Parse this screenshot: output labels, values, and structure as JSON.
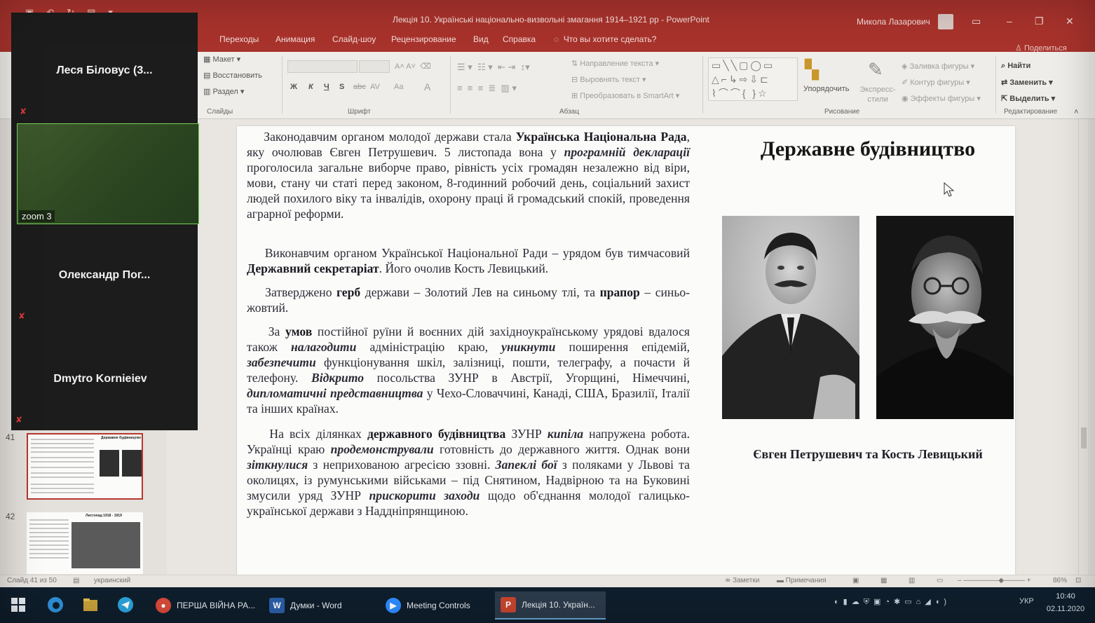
{
  "window": {
    "title": "Лекція 10. Українські національно-визвольні змагання 1914–1921 рр  -  PowerPoint",
    "user": "Микола Лазарович"
  },
  "menu": {
    "tabs": [
      "Переходы",
      "Анимация",
      "Слайд-шоу",
      "Рецензирование",
      "Вид",
      "Справка"
    ],
    "search": "Что вы хотите сделать?",
    "share": "Поделиться"
  },
  "ribbon": {
    "slides_group": {
      "layout": "Макет",
      "reset": "Восстановить",
      "section": "Раздел",
      "label": "Слайды"
    },
    "font_group": {
      "label": "Шрифт",
      "bold": "Ж",
      "italic": "К",
      "underline": "Ч",
      "shadow": "S",
      "strike": "abc",
      "spacing": "AV",
      "case": "Aa",
      "color": "A"
    },
    "paragraph_group": {
      "label": "Абзац",
      "text_direction": "Направление текста",
      "align_text": "Выровнять текст",
      "smartart": "Преобразовать в SmartArt"
    },
    "drawing_group": {
      "label": "Рисование",
      "arrange": "Упорядочить",
      "quick_styles": "Экспресс-стили",
      "fill": "Заливка фигуры",
      "outline": "Контур фигуры",
      "effects": "Эффекты фигуры"
    },
    "editing_group": {
      "label": "Редактирование",
      "find": "Найти",
      "replace": "Заменить",
      "select": "Выделить"
    }
  },
  "zoom": {
    "participants": [
      {
        "name": "Леся Біловус (3...",
        "muted": true
      },
      {
        "name": "zoom 3",
        "video": true
      },
      {
        "name": "Олександр  Пог...",
        "muted": true
      },
      {
        "name": "Dmytro Kornieiev",
        "muted": true
      }
    ]
  },
  "thumbnails": [
    {
      "number": "41",
      "title": "Державне будівництво",
      "selected": true
    },
    {
      "number": "42",
      "title": "Листопад 1918 - 1919",
      "selected": false
    }
  ],
  "slide": {
    "title": "Державне будівництво",
    "caption": "Євген Петрушевич та Кость Левицький",
    "paragraphs": {
      "p1_a": "Законодавчим органом молодої держави стала ",
      "p1_b": "Українська Національна Рада",
      "p1_c": ", яку очолював Євген Петрушевич. 5 листопада вона у ",
      "p1_d": "програмній декларації",
      "p1_e": " проголосила загальне виборче право, рівність усіх громадян незалежно від віри, мови, стану чи статі перед законом, 8-годинний робочий день, соціальний захист людей похилого віку та інвалідів, охорону праці й громадський спокій, проведення аграрної реформи.",
      "p2_a": "Виконавчим органом Української Національної Ради – урядом був тимчасовий ",
      "p2_b": "Державний секретаріат",
      "p2_c": ". Його очолив Кость Левицький.",
      "p3_a": "Затверджено ",
      "p3_b": "герб",
      "p3_c": " держави – Золотий Лев на синьому тлі, та ",
      "p3_d": "прапор",
      "p3_e": " – синьо-жовтий.",
      "p4_a": "За ",
      "p4_b": "умов",
      "p4_c": " постійної руїни й воєнних дій західноукраїнському урядові вдалося також ",
      "p4_d": "налагодити",
      "p4_e": " адміністрацію краю, ",
      "p4_f": "уникнути",
      "p4_g": " поширення епідемій, ",
      "p4_h": "забезпечити",
      "p4_i": " функціонування шкіл, залізниці, пошти, телеграфу, а почасти й телефону. ",
      "p4_j": "Відкрито",
      "p4_k": " посольства ЗУНР в Австрії, Угорщині, Німеччині, ",
      "p4_l": "дипломатичні представництва",
      "p4_m": " у Чехо-Словаччині, Канаді, США, Бразилії, Італії та інших країнах.",
      "p5_a": "На всіх ділянках ",
      "p5_b": "державного будівництва",
      "p5_c": " ЗУНР ",
      "p5_d": "кипіла",
      "p5_e": " напружена робота. Українці краю ",
      "p5_f": "продемонстрували",
      "p5_g": " готовність до державного життя. Однак вони ",
      "p5_h": "зіткнулися",
      "p5_i": " з неприхованою агресією ззовні. ",
      "p5_j": "Запеклі бої",
      "p5_k": " з поляками у Львові та околицях, із румунськими військами – під Снятином, Надвірною та на Буковині змусили уряд ЗУНР ",
      "p5_l": "прискорити заходи",
      "p5_m": " щодо об'єднання молодої галицько-української держави з Наддніпрянщиною."
    }
  },
  "statusbar": {
    "slide_count": "Слайд 41 из 50",
    "language": "украинский",
    "notes": "Заметки",
    "comments": "Примечания",
    "zoom": "86%"
  },
  "taskbar": {
    "apps": [
      {
        "label": "ПЕРША ВІЙНА РА...",
        "icon": "chrome-icon"
      },
      {
        "label": "Думки - Word",
        "icon": "word-icon"
      },
      {
        "label": "Meeting Controls",
        "icon": "zoom-icon"
      },
      {
        "label": "Лекція 10. Україн...",
        "icon": "powerpoint-icon",
        "active": true
      }
    ],
    "language": "УКР",
    "time": "10:40",
    "date": "02.11.2020"
  }
}
